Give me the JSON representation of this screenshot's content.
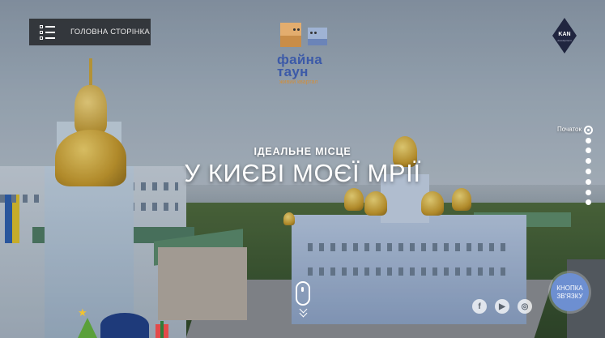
{
  "header": {
    "home_button_label": "ГОЛОВНА СТОРІНКА",
    "logo": {
      "line1": "файна",
      "line2": "таун",
      "subtitle": "живий квартал"
    },
    "partner_logo": {
      "text": "KAN",
      "subtext": "development"
    }
  },
  "hero": {
    "tagline": "ІДЕАЛЬНЕ МІСЦЕ",
    "headline": "У КИЄВІ МОЄЇ МРІЇ"
  },
  "section_nav": {
    "active_label": "Початок",
    "total_dots": 8,
    "active_index": 0
  },
  "social": [
    {
      "name": "facebook-icon",
      "glyph": "f"
    },
    {
      "name": "youtube-icon",
      "glyph": "▶"
    },
    {
      "name": "instagram-icon",
      "glyph": "◎"
    }
  ],
  "contact_button": {
    "line1": "КНОПКА",
    "line2": "ЗВ'ЯЗКУ"
  },
  "colors": {
    "logo_blue": "#3c5aa8",
    "logo_orange": "#d08f3c",
    "contact_blue": "#6d8fd1",
    "home_button_bg": "#28292e"
  }
}
